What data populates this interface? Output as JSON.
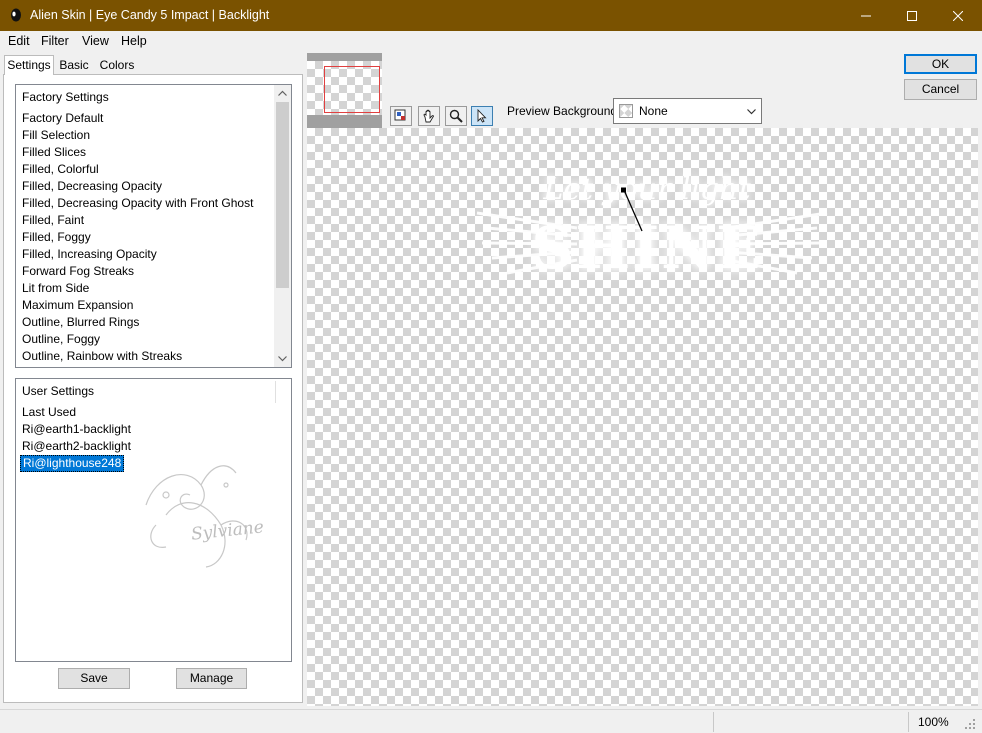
{
  "window": {
    "title": "Alien Skin | Eye Candy 5 Impact | Backlight",
    "controls": [
      "minimize",
      "maximize",
      "close"
    ],
    "titlebar_color": "#7a5200"
  },
  "menu": {
    "items": [
      {
        "label": "Edit"
      },
      {
        "label": "Filter"
      },
      {
        "label": "View"
      },
      {
        "label": "Help"
      }
    ]
  },
  "tabs": [
    {
      "label": "Settings",
      "active": true
    },
    {
      "label": "Basic",
      "active": false
    },
    {
      "label": "Colors",
      "active": false
    }
  ],
  "factory_settings": {
    "header": "Factory Settings",
    "items": [
      "Factory Default",
      "Fill Selection",
      "Filled Slices",
      "Filled, Colorful",
      "Filled, Decreasing Opacity",
      "Filled, Decreasing Opacity with Front Ghost",
      "Filled, Faint",
      "Filled, Foggy",
      "Filled, Increasing Opacity",
      "Forward Fog Streaks",
      "Lit from Side",
      "Maximum Expansion",
      "Outline, Blurred Rings",
      "Outline, Foggy",
      "Outline, Rainbow with Streaks"
    ]
  },
  "user_settings": {
    "header": "User Settings",
    "items": [
      {
        "label": "Last Used",
        "selected": false
      },
      {
        "label": "Ri@earth1-backlight",
        "selected": false
      },
      {
        "label": "Ri@earth2-backlight",
        "selected": false
      },
      {
        "label": "Ri@lighthouse248",
        "selected": true
      }
    ],
    "watermark_text": "Sylviane"
  },
  "buttons": {
    "save": "Save",
    "manage": "Manage",
    "ok": "OK",
    "cancel": "Cancel"
  },
  "preview": {
    "background_label": "Preview Background:",
    "background_value": "None",
    "tools": [
      "reset-view-icon",
      "hand-pan-icon",
      "zoom-icon",
      "pointer-arrow-icon"
    ],
    "active_tool": "pointer-arrow-icon",
    "artwork_text_top": "Let your light",
    "artwork_text_main": "SHINE"
  },
  "status": {
    "zoom": "100%"
  },
  "colors": {
    "accent": "#0078d7",
    "panel_bg": "#f0f0f0"
  }
}
